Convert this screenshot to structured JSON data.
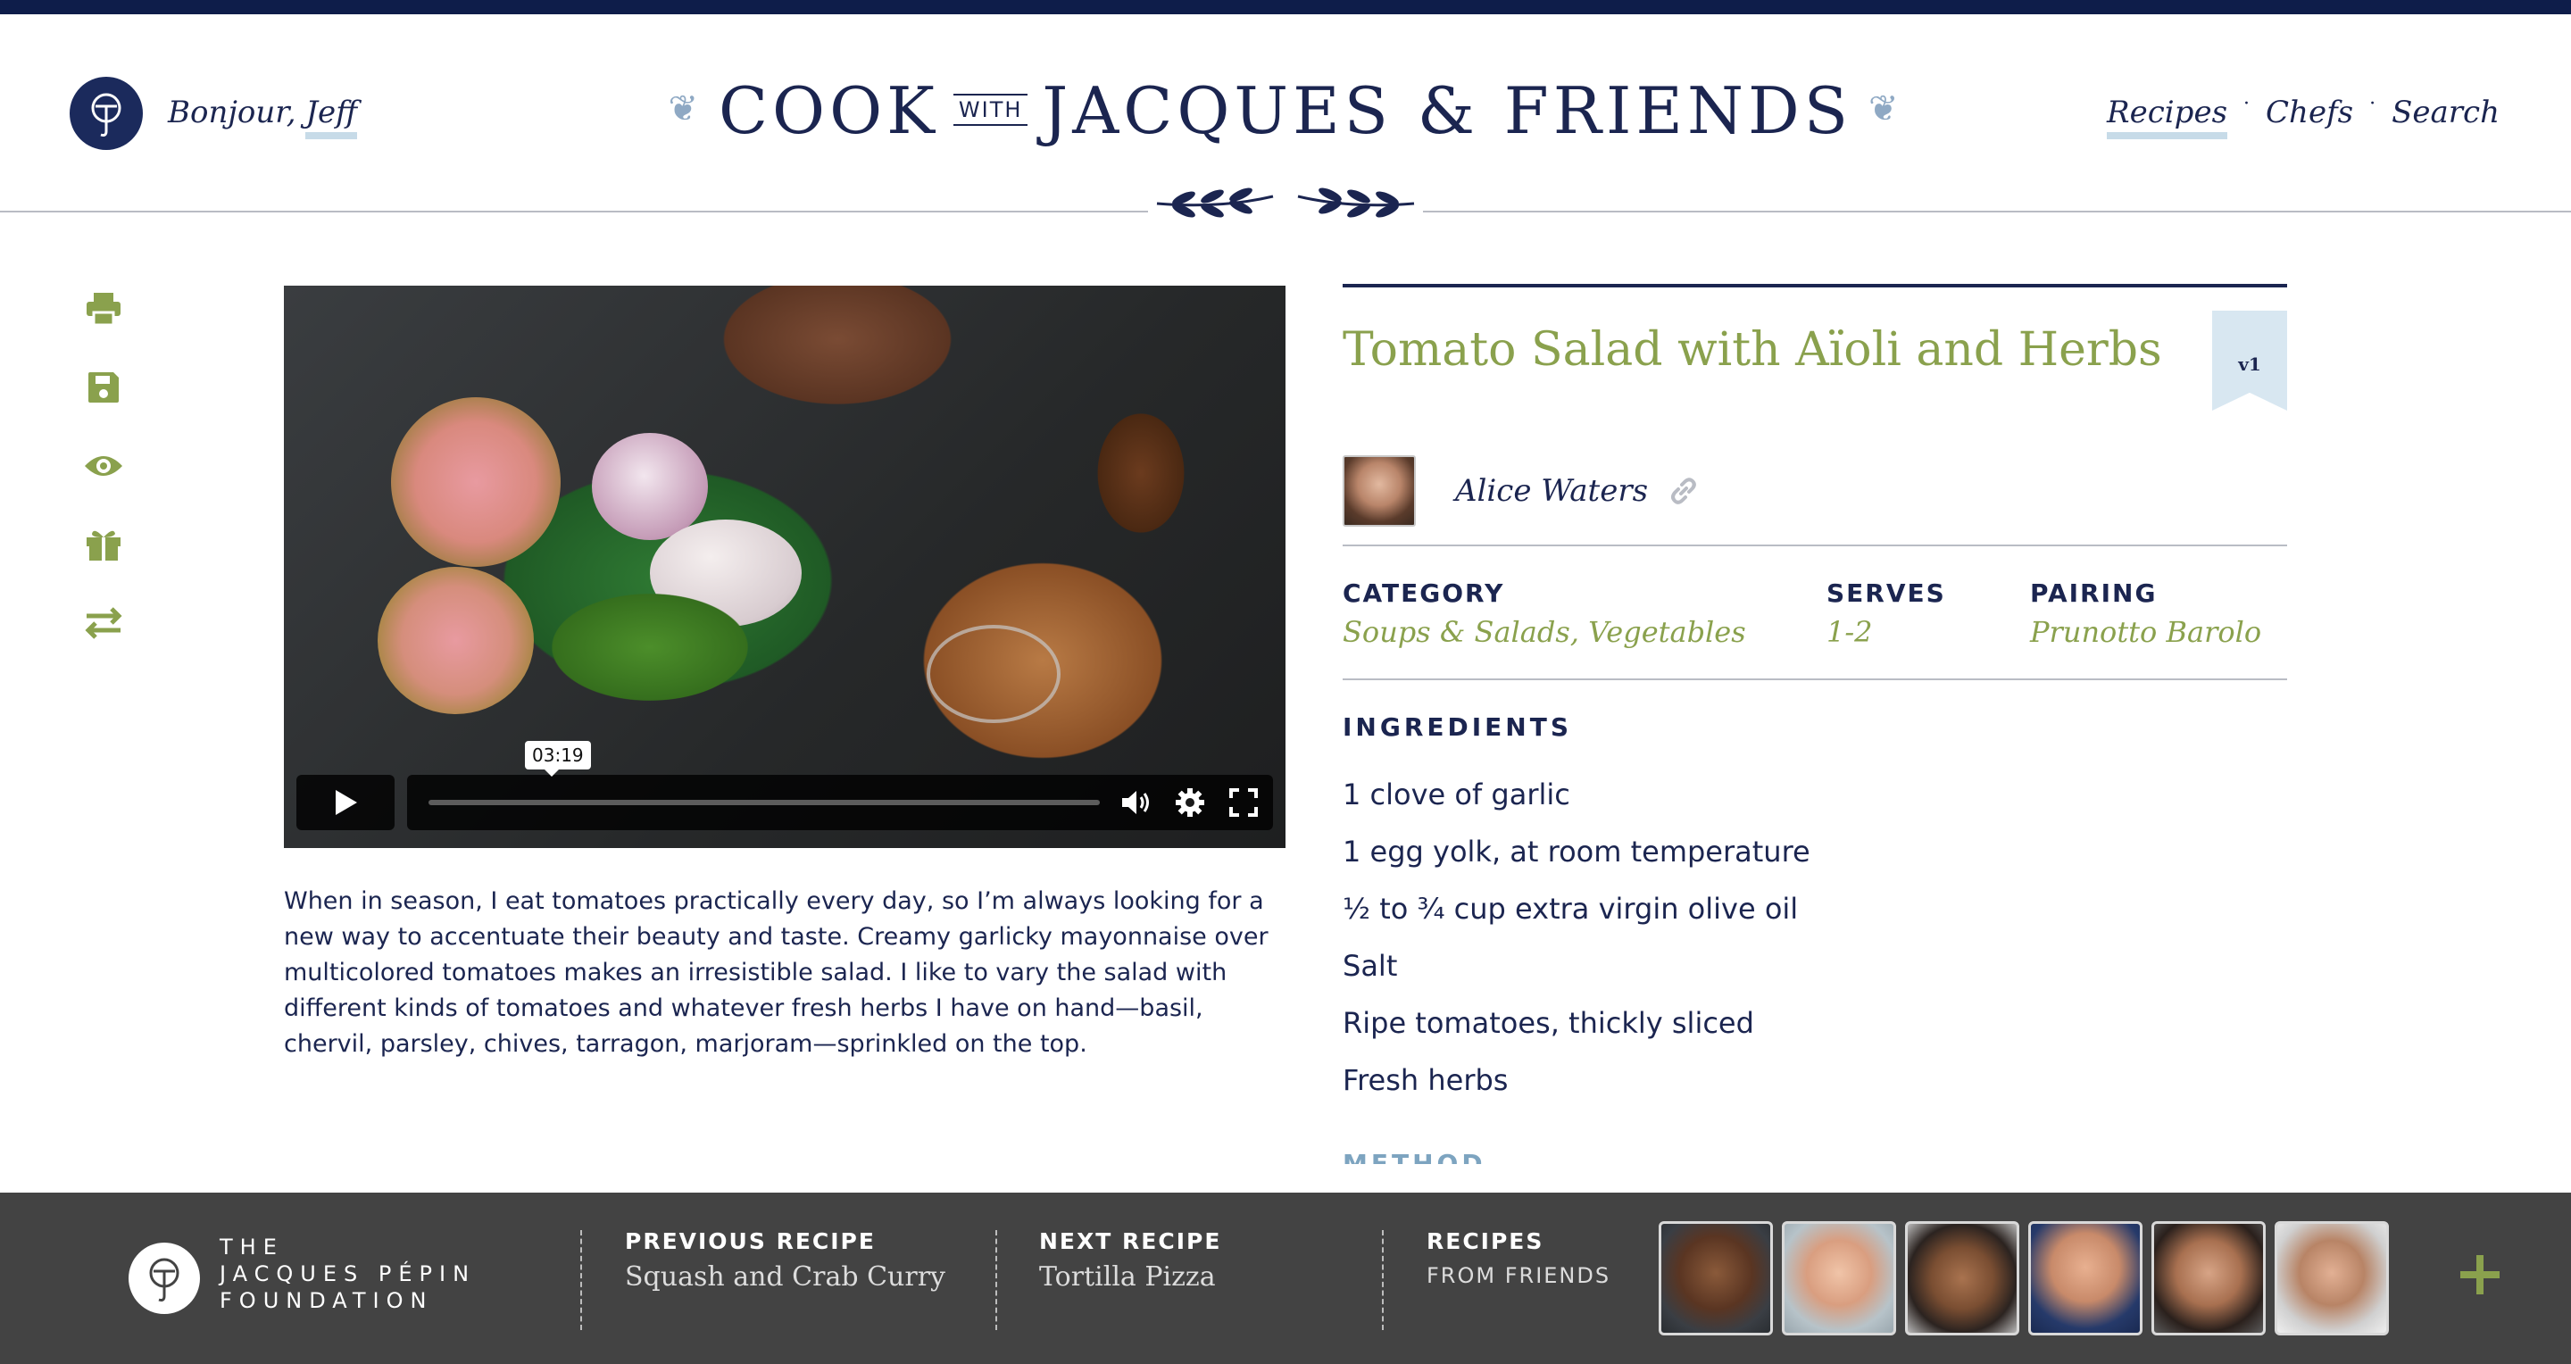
{
  "header": {
    "greeting_prefix": "Bonjour, ",
    "user_name": "Jeff",
    "site_title_part1": "COOK",
    "site_title_with": "WITH",
    "site_title_part2": "JACQUES & FRIENDS",
    "nav": [
      {
        "label": "Recipes",
        "active": true
      },
      {
        "label": "Chefs",
        "active": false
      },
      {
        "label": "Search",
        "active": false
      }
    ]
  },
  "tools": [
    "print-icon",
    "save-icon",
    "eye-icon",
    "gift-icon",
    "swap-icon"
  ],
  "video": {
    "timecode": "03:19",
    "controls": [
      "play-icon",
      "volume-icon",
      "settings-icon",
      "fullscreen-icon"
    ]
  },
  "description": "When in season, I eat tomatoes practically every day, so I’m always looking for a new way to accentuate their beauty and taste. Creamy garlicky mayonnaise over multicolored tomatoes makes an irresistible salad. I like to vary the salad with different kinds of tomatoes and whatever fresh herbs I have on hand—basil, chervil, parsley, chives, tarragon, marjoram—sprinkled on the top.",
  "recipe": {
    "title": "Tomato Salad with Aïoli and Herbs",
    "version": "v1",
    "chef_name": "Alice Waters",
    "category_label": "CATEGORY",
    "category_value": "Soups & Salads, Vegetables",
    "serves_label": "SERVES",
    "serves_value": "1-2",
    "pairing_label": "PAIRING",
    "pairing_value": "Prunotto Barolo",
    "ingredients_label": "INGREDIENTS",
    "ingredients": [
      "1 clove of garlic",
      "1 egg yolk, at room temperature",
      "½ to ¾ cup extra virgin olive oil",
      "Salt",
      "Ripe tomatoes, thickly sliced",
      "Fresh herbs"
    ],
    "method_label": "METHOD"
  },
  "footer": {
    "foundation_line1": "THE",
    "foundation_line2": "JACQUES PÉPIN",
    "foundation_line3": "FOUNDATION",
    "previous_label": "PREVIOUS RECIPE",
    "previous_title": "Squash and Crab Curry",
    "next_label": "NEXT RECIPE",
    "next_title": "Tortilla Pizza",
    "friends_label": "RECIPES",
    "friends_sub": "FROM FRIENDS",
    "friend_count": 6
  },
  "colors": {
    "navy": "#1b2550",
    "olive": "#8aa14d",
    "light_blue": "#c7dbe8",
    "footer_bg": "#434343"
  }
}
